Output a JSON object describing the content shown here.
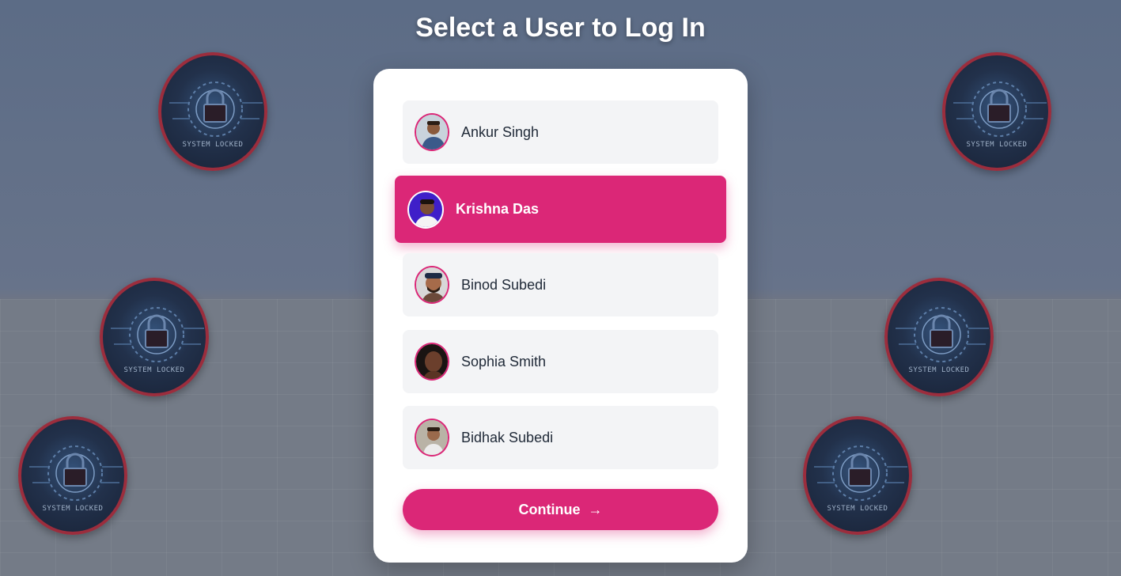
{
  "page": {
    "title": "Select a User to Log In"
  },
  "badges": {
    "caption": "SYSTEM LOCKED",
    "icon": "lock-icon"
  },
  "users": [
    {
      "name": "Ankur Singh",
      "selected": false
    },
    {
      "name": "Krishna Das",
      "selected": true
    },
    {
      "name": "Binod Subedi",
      "selected": false
    },
    {
      "name": "Sophia Smith",
      "selected": false
    },
    {
      "name": "Bidhak Subedi",
      "selected": false
    }
  ],
  "actions": {
    "continue_label": "Continue",
    "continue_icon": "arrow-right-icon",
    "continue_glyph": "→"
  },
  "colors": {
    "accent": "#db2777",
    "badge_ring": "#9b2d3d",
    "item_bg": "#f3f4f6"
  }
}
